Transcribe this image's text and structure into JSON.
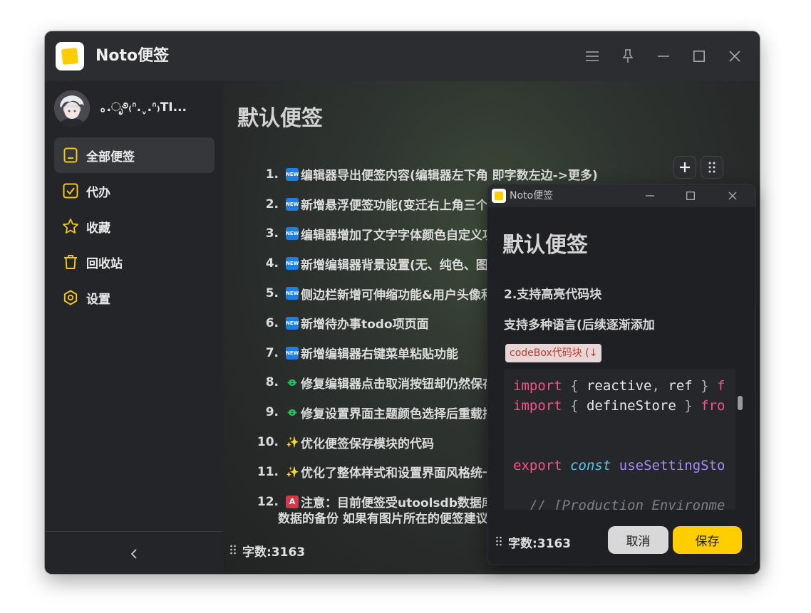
{
  "app": {
    "title": "Noto便签"
  },
  "titlebar": {
    "icons": [
      "menu-icon",
      "pin-icon",
      "minimize-icon",
      "maximize-icon",
      "close-icon"
    ]
  },
  "sidebar": {
    "username": "｡.ೃ࿔₍ᐢ.ˬ.ᐢ₎TI...",
    "items": [
      {
        "label": "全部便签",
        "icon": "note-icon",
        "active": true
      },
      {
        "label": "代办",
        "icon": "check-square-icon",
        "active": false
      },
      {
        "label": "收藏",
        "icon": "star-icon",
        "active": false
      },
      {
        "label": "回收站",
        "icon": "trash-icon",
        "active": false
      },
      {
        "label": "设置",
        "icon": "settings-icon",
        "active": false
      }
    ],
    "accent": "#f5c518"
  },
  "editor": {
    "title": "默认便签",
    "items": [
      {
        "num": "1.",
        "icon": "new",
        "text": "编辑器导出便签内容(编辑器左下角 即字数左边->更多)"
      },
      {
        "num": "2.",
        "icon": "new",
        "text": "新增悬浮便签功能(变迁右上角三个点"
      },
      {
        "num": "3.",
        "icon": "new",
        "text": "编辑器增加了文字字体颜色自定义功"
      },
      {
        "num": "4.",
        "icon": "new",
        "text": "新增编辑器背景设置(无、纯色、图片"
      },
      {
        "num": "5.",
        "icon": "new",
        "text": "侧边栏新增可伸缩功能&用户头像和"
      },
      {
        "num": "6.",
        "icon": "new",
        "text": "新增待办事todo项页面"
      },
      {
        "num": "7.",
        "icon": "new",
        "text": "新增编辑器右键菜单粘贴功能"
      },
      {
        "num": "8.",
        "icon": "fix",
        "text": "修复编辑器点击取消按钮却仍然保存"
      },
      {
        "num": "9.",
        "icon": "fix",
        "text": "修复设置界面主题颜色选择后重载插"
      },
      {
        "num": "10.",
        "icon": "spark",
        "text": "优化便签保存模块的代码"
      },
      {
        "num": "11.",
        "icon": "spark",
        "text": "优化了整体样式和设置界面风格统一"
      },
      {
        "num": "12.",
        "icon": "warn",
        "text": "注意：目前便签受utoolsdb数据库限"
      }
    ],
    "item12_cont": "数据的备份 如果有图片所在的便签建议",
    "wordcount": "字数:3163",
    "icon_glyphs": {
      "new": "NEW",
      "fix": "ꝋ",
      "spark": "✨",
      "warn": "A"
    }
  },
  "float_window": {
    "title": "Noto便签",
    "heading": "默认便签",
    "sub1": "2.支持高亮代码块",
    "sub2": "支持多种语言(后续逐渐添加",
    "tag": "codeBox代码块 (↓",
    "code_lines": [
      [
        {
          "t": "import",
          "c": "kw"
        },
        {
          "t": " { ",
          "c": "punct"
        },
        {
          "t": "reactive",
          "c": ""
        },
        {
          "t": ", ",
          "c": "punct"
        },
        {
          "t": "ref",
          "c": ""
        },
        {
          "t": " } ",
          "c": "punct"
        },
        {
          "t": "f",
          "c": "kw"
        }
      ],
      [
        {
          "t": "import",
          "c": "kw"
        },
        {
          "t": " { ",
          "c": "punct"
        },
        {
          "t": "defineStore",
          "c": ""
        },
        {
          "t": " } ",
          "c": "punct"
        },
        {
          "t": "fro",
          "c": "kw"
        }
      ],
      [],
      [],
      [
        {
          "t": "export",
          "c": "kw"
        },
        {
          "t": " ",
          "c": ""
        },
        {
          "t": "const",
          "c": "const"
        },
        {
          "t": " ",
          "c": ""
        },
        {
          "t": "useSettingSto",
          "c": "fn"
        }
      ],
      [],
      [
        {
          "t": "  // [Production Environme",
          "c": "cm"
        }
      ]
    ],
    "wordcount": "字数:3163",
    "cancel": "取消",
    "save": "保存"
  }
}
